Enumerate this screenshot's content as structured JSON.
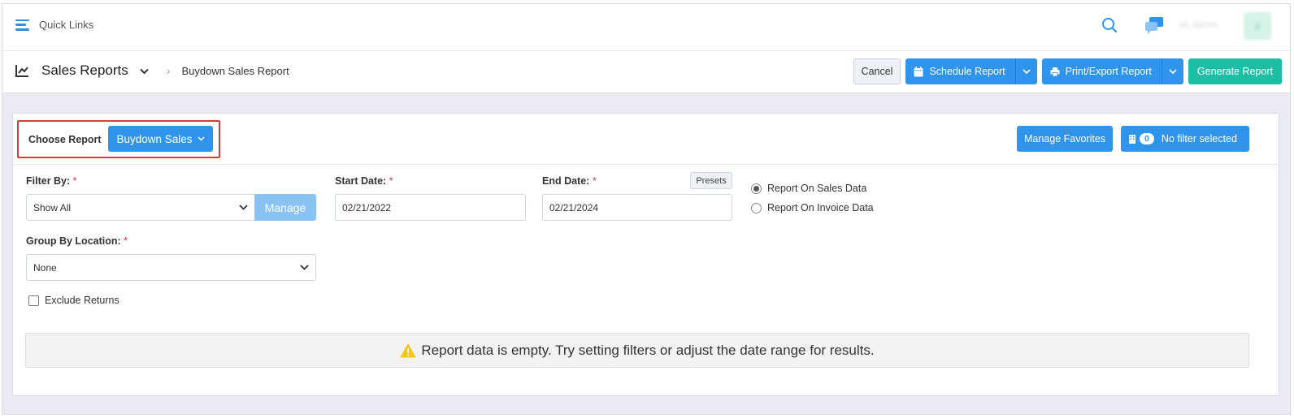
{
  "topbar": {
    "quick_links": "Quick Links",
    "user_name": "Hi, Admin",
    "avatar_initial": "A",
    "icons": [
      "menu-icon",
      "search-icon",
      "chat-icon"
    ]
  },
  "header": {
    "title": "Sales Reports",
    "breadcrumb_sep": "›",
    "breadcrumb": "Buydown Sales Report",
    "cancel_label": "Cancel",
    "schedule_label": "Schedule Report",
    "print_label": "Print/Export Report",
    "generate_label": "Generate Report"
  },
  "choose": {
    "label": "Choose Report",
    "button": "Buydown Sales"
  },
  "favorites_label": "Manage Favorites",
  "filter_badge": {
    "count": "0",
    "label": "No filter selected"
  },
  "filters": {
    "filter_by_label": "Filter By:",
    "filter_by_value": "Show All",
    "manage_label": "Manage",
    "start_label": "Start Date:",
    "start_value": "02/21/2022",
    "end_label": "End Date:",
    "end_value": "02/21/2024",
    "presets_label": "Presets",
    "group_label": "Group By Location:",
    "group_value": "None",
    "required_mark": "*",
    "radio_sales": "Report On Sales Data",
    "radio_invoice": "Report On Invoice Data",
    "exclude_returns": "Exclude Returns"
  },
  "alert": {
    "message": "Report data is empty. Try setting filters or adjust the date range for results."
  },
  "colors": {
    "primary": "#2f95ec",
    "teal": "#1dbfa4",
    "highlight": "#d93b3b",
    "warning": "#f5c518"
  }
}
